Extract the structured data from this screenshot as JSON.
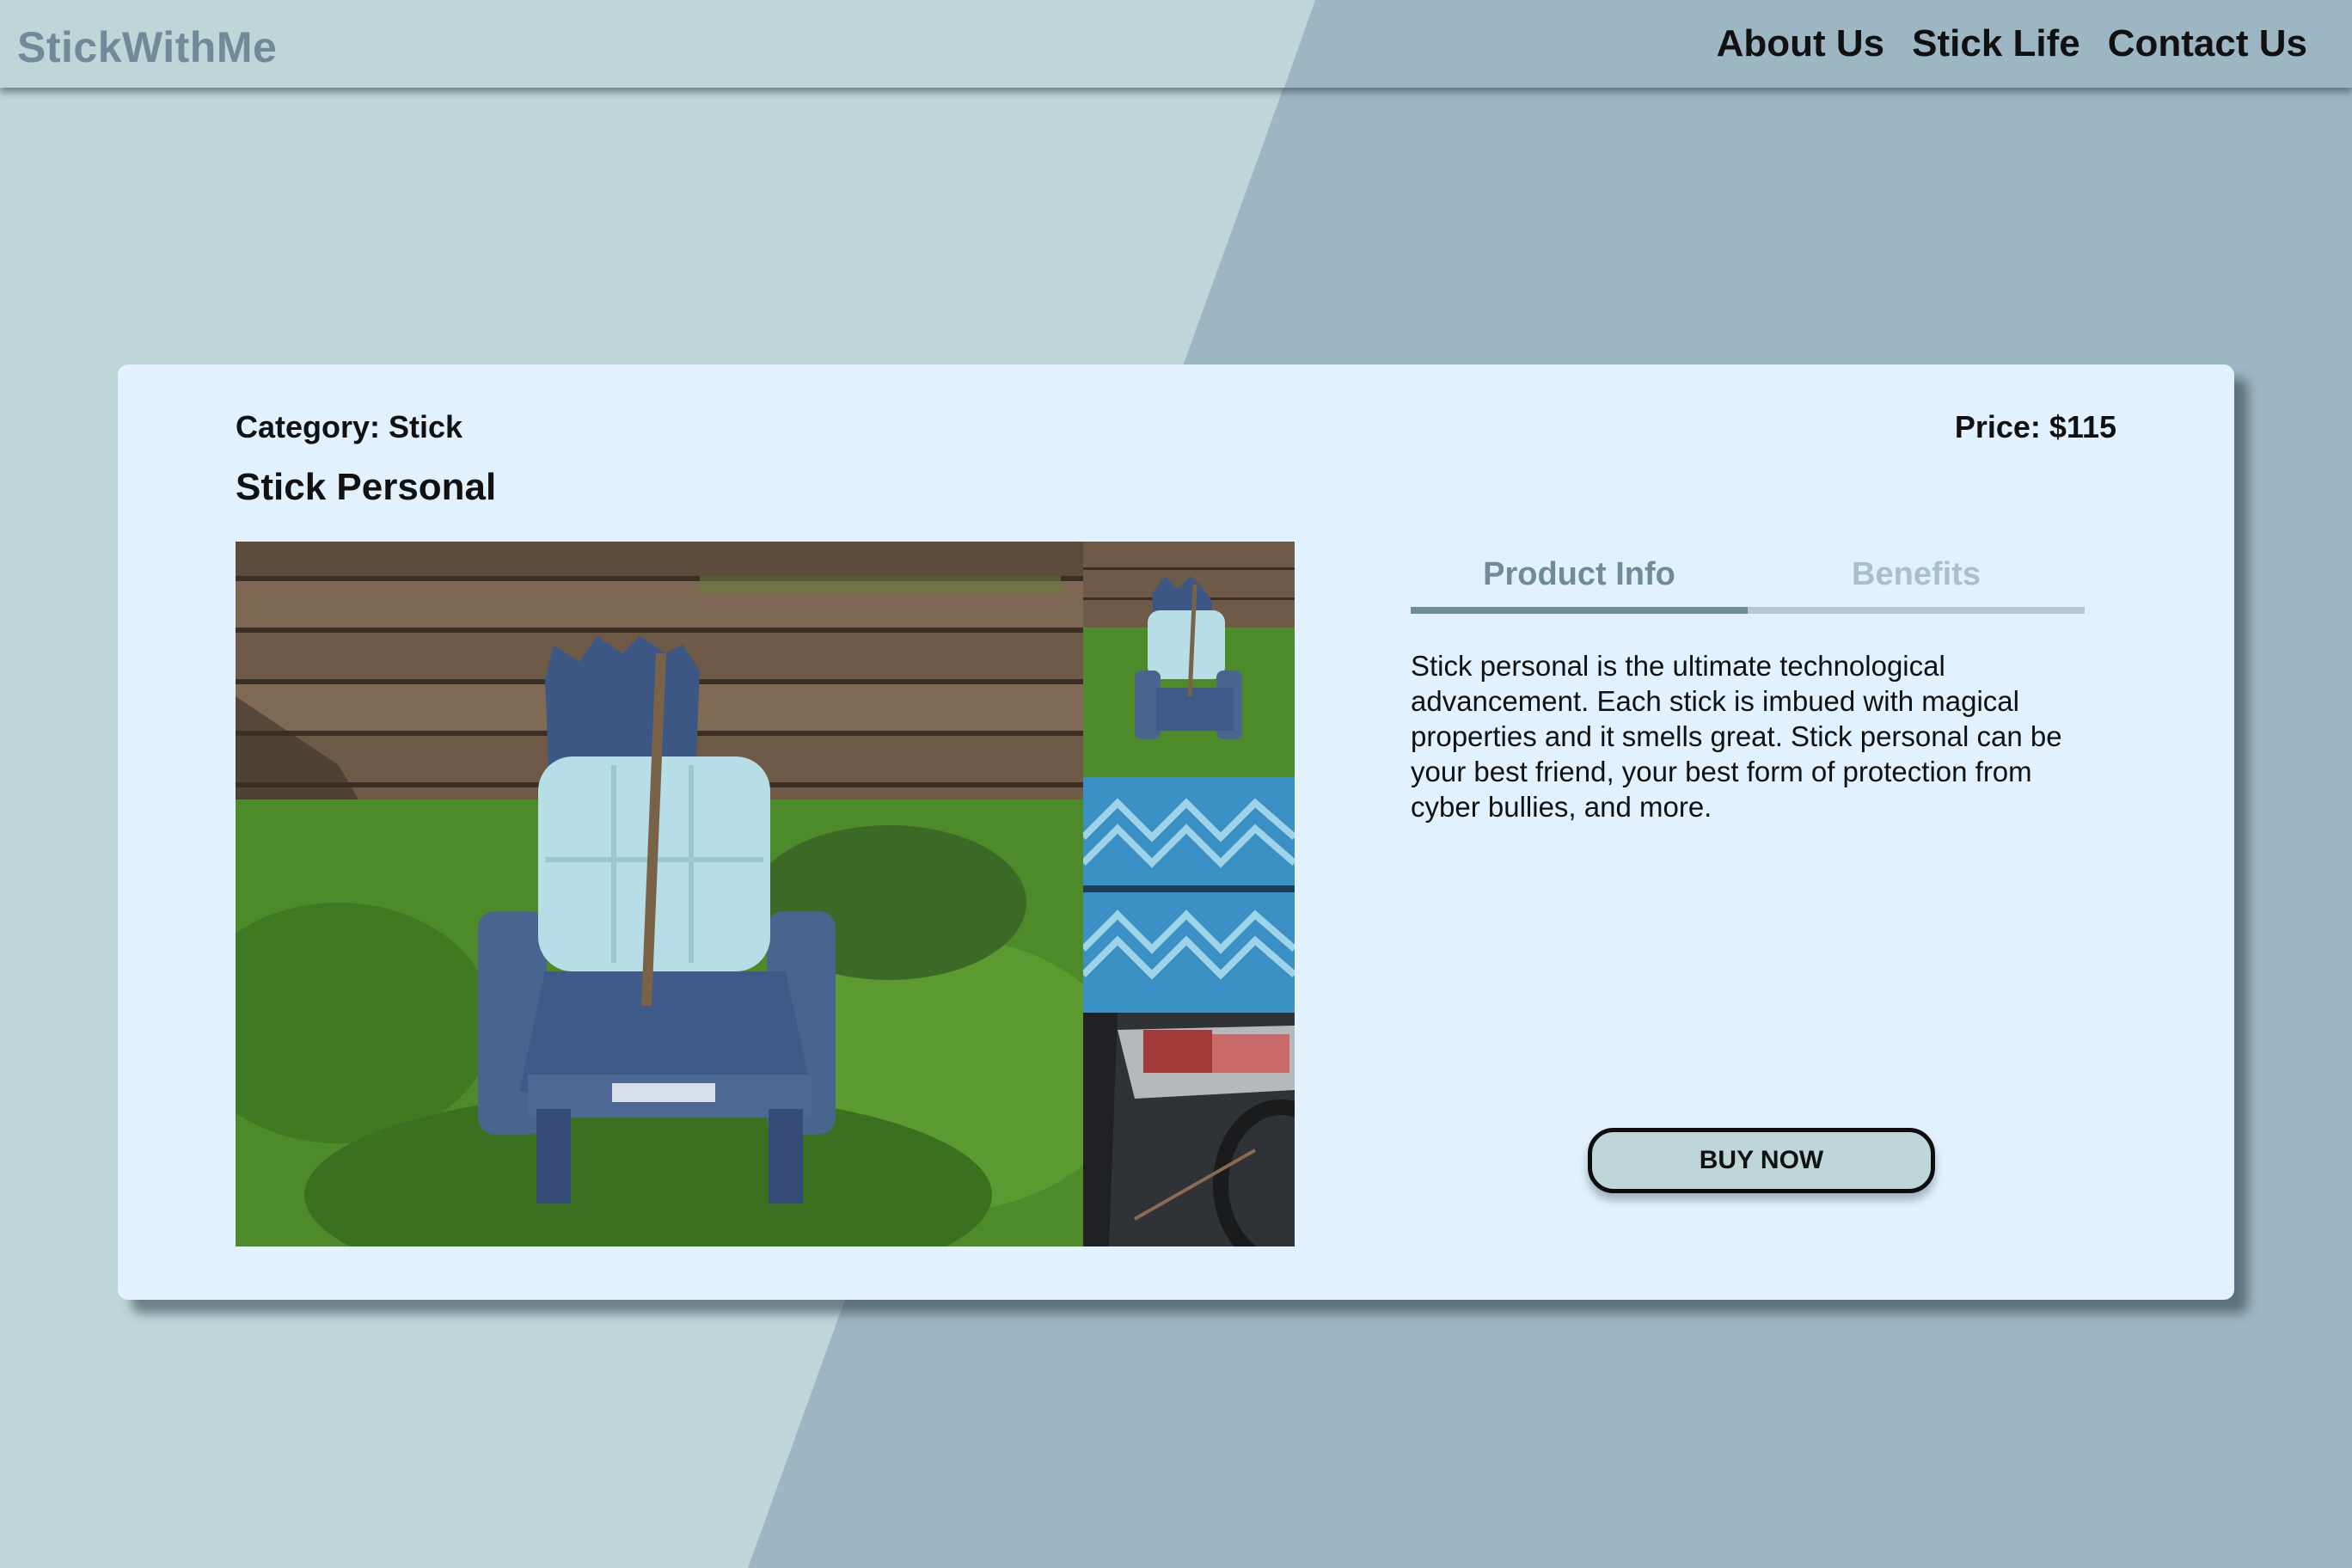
{
  "colors": {
    "background_light": "#bed6d8",
    "background_dark": "#9db6c4",
    "card": "#e1f1fd",
    "logo": "#6f8b99",
    "tab_active": "#6f8b99",
    "tab_inactive": "#a9c0cc",
    "button_fill": "#bfd6d9"
  },
  "header": {
    "logo": "StickWithMe",
    "nav": [
      {
        "label": "About Us"
      },
      {
        "label": "Stick Life"
      },
      {
        "label": "Contact Us"
      }
    ]
  },
  "product": {
    "category": "Category: Stick",
    "title": "Stick Personal",
    "price": "Price: $115",
    "tabs": [
      {
        "label": "Product Info",
        "active": true
      },
      {
        "label": "Benefits",
        "active": false
      }
    ],
    "description": "Stick personal is the ultimate technological advancement. Each stick is imbued with magical properties and it smells great. Stick personal can be your best friend, your best form of protection from cyber bullies, and more.",
    "buy_label": "BUY NOW"
  }
}
